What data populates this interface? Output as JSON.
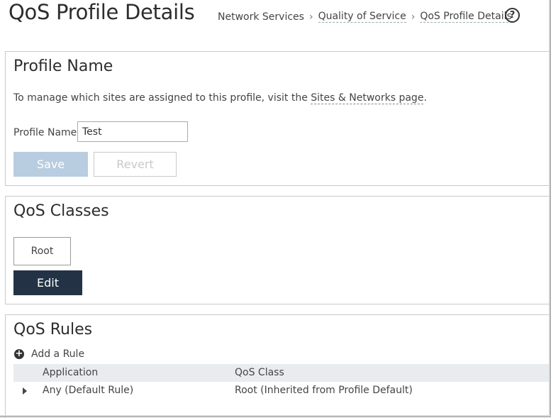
{
  "page": {
    "title": "QoS Profile Details",
    "breadcrumb": [
      "Network Services",
      "Quality of Service",
      "QoS Profile Details"
    ],
    "help_glyph": "?"
  },
  "profile_name": {
    "title": "Profile Name",
    "info_text": "To manage which sites are assigned to this profile, visit the ",
    "info_link": "Sites & Networks page",
    "info_end": ".",
    "field_label": "Profile Name",
    "field_value": "Test",
    "save_label": "Save",
    "revert_label": "Revert"
  },
  "qos_classes": {
    "title": "QoS Classes",
    "root_label": "Root",
    "edit_label": "Edit"
  },
  "qos_rules": {
    "title": "QoS Rules",
    "add_rule_label": "Add a Rule",
    "add_icon_glyph": "+",
    "columns": [
      "Application",
      "QoS Class"
    ],
    "rows": [
      {
        "application": "Any (Default Rule)",
        "qos_class": "Root (Inherited from Profile Default)"
      }
    ]
  },
  "icons": {
    "help": "help-circle-icon",
    "add": "plus-circle-icon",
    "expand": "expand-triangle-icon"
  },
  "colors": {
    "save_button": "#b9cde0",
    "edit_button": "#233345",
    "table_header": "#e9ecef"
  }
}
